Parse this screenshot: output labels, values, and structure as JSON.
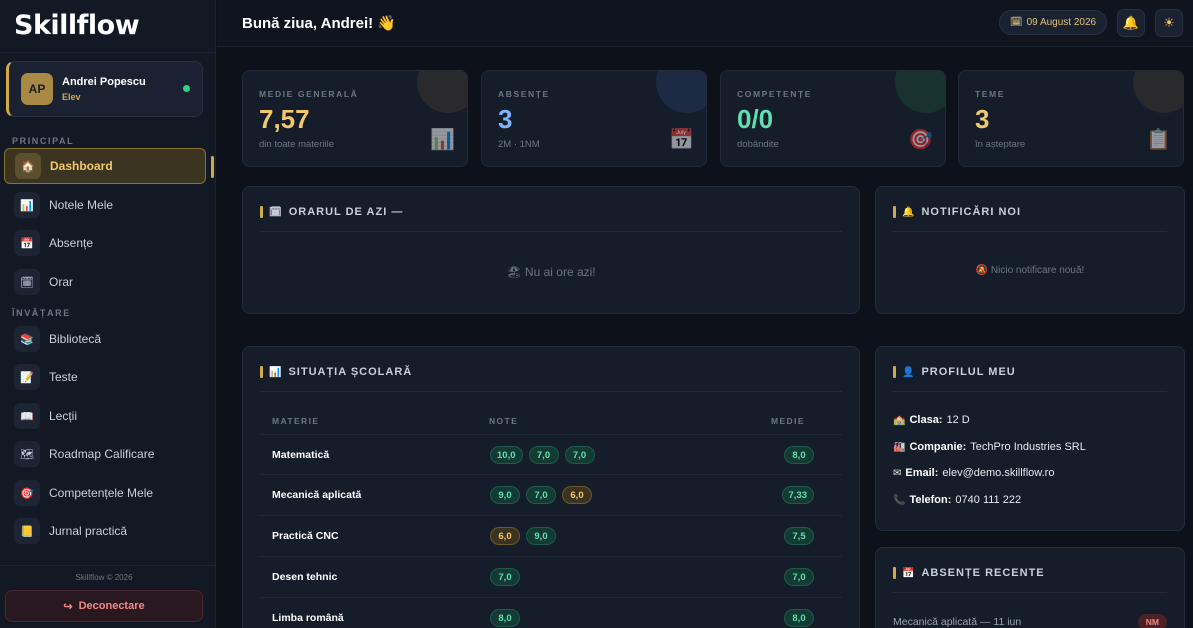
{
  "app": {
    "name": "Skillflow",
    "copyright": "Skillflow © 2026",
    "logout": "Deconectare"
  },
  "user": {
    "initials": "AP",
    "name": "Andrei Popescu",
    "role": "Elev"
  },
  "sidebar": {
    "sections": {
      "principal": "PRINCIPAL",
      "invatare": "ÎNVĂȚARE"
    },
    "items": [
      {
        "label": "Dashboard",
        "icon": "🏠"
      },
      {
        "label": "Notele Mele",
        "icon": "📊"
      },
      {
        "label": "Absențe",
        "icon": "📅"
      },
      {
        "label": "Orar",
        "icon": "🗓"
      },
      {
        "label": "Bibliotecă",
        "icon": "📚"
      },
      {
        "label": "Teste",
        "icon": "📝"
      },
      {
        "label": "Lecții",
        "icon": "📖"
      },
      {
        "label": "Roadmap Calificare",
        "icon": "🗺"
      },
      {
        "label": "Competențele Mele",
        "icon": "🎯"
      },
      {
        "label": "Jurnal practică",
        "icon": "📒"
      }
    ]
  },
  "header": {
    "greeting": "Bună ziua, Andrei! 👋",
    "date": "09 August 2026",
    "date_icon": "🗓",
    "bell_icon": "🔔",
    "theme_icon": "☀"
  },
  "stats": [
    {
      "label": "MEDIE GENERALĂ",
      "value": "7,57",
      "sub": "din toate materiile",
      "color": "#f1c96a",
      "icon": "📊"
    },
    {
      "label": "ABSENȚE",
      "value": "3",
      "sub": "2M · 1NM",
      "color": "#7fb2ff",
      "icon": "📅"
    },
    {
      "label": "COMPETENȚE",
      "value": "0/0",
      "sub": "dobândite",
      "color": "#5fe0b0",
      "icon": "🎯"
    },
    {
      "label": "TEME",
      "value": "3",
      "sub": "în așteptare",
      "color": "#f1c96a",
      "icon": "📋"
    }
  ],
  "schedule": {
    "title": "ORARUL DE AZI —",
    "icon": "🗓",
    "empty": "🏖 Nu ai ore azi!"
  },
  "notifications": {
    "title": "NOTIFICĂRI NOI",
    "icon": "🔔",
    "empty": "🔕 Nicio notificare nouă!"
  },
  "grades": {
    "title": "SITUAȚIA ȘCOLARĂ",
    "icon": "📊",
    "columns": {
      "subject": "MATERIE",
      "grades": "NOTE",
      "average": "MEDIE"
    },
    "rows": [
      {
        "subject": "Matematică",
        "grades": [
          {
            "v": "10,0",
            "t": "g"
          },
          {
            "v": "7,0",
            "t": "g"
          },
          {
            "v": "7,0",
            "t": "g"
          }
        ],
        "average": "8,0"
      },
      {
        "subject": "Mecanică aplicată",
        "grades": [
          {
            "v": "9,0",
            "t": "g"
          },
          {
            "v": "7,0",
            "t": "g"
          },
          {
            "v": "6,0",
            "t": "y"
          }
        ],
        "average": "7,33"
      },
      {
        "subject": "Practică CNC",
        "grades": [
          {
            "v": "6,0",
            "t": "y"
          },
          {
            "v": "9,0",
            "t": "g"
          }
        ],
        "average": "7,5"
      },
      {
        "subject": "Desen tehnic",
        "grades": [
          {
            "v": "7,0",
            "t": "g"
          }
        ],
        "average": "7,0"
      },
      {
        "subject": "Limba română",
        "grades": [
          {
            "v": "8,0",
            "t": "g"
          }
        ],
        "average": "8,0"
      }
    ]
  },
  "profile": {
    "title": "PROFILUL MEU",
    "icon": "👤",
    "lines": [
      {
        "icon": "🏫",
        "key": "Clasa:",
        "value": "12 D"
      },
      {
        "icon": "🏭",
        "key": "Companie:",
        "value": "TechPro Industries SRL"
      },
      {
        "icon": "✉",
        "key": "Email:",
        "value": "elev@demo.skillflow.ro"
      },
      {
        "icon": "📞",
        "key": "Telefon:",
        "value": "0740 111 222"
      }
    ]
  },
  "recent_absences": {
    "title": "ABSENȚE RECENTE",
    "icon": "📅",
    "first": {
      "text": "Mecanică aplicată — 11 iun",
      "badge": "NM"
    }
  }
}
